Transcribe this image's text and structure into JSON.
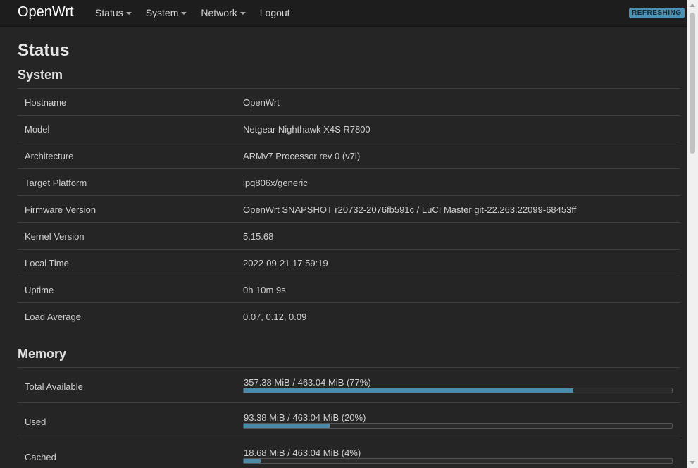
{
  "nav": {
    "brand": "OpenWrt",
    "menu": [
      {
        "label": "Status",
        "has_dropdown": true
      },
      {
        "label": "System",
        "has_dropdown": true
      },
      {
        "label": "Network",
        "has_dropdown": true
      },
      {
        "label": "Logout",
        "has_dropdown": false
      }
    ],
    "badge": "REFRESHING"
  },
  "page_title": "Status",
  "system": {
    "title": "System",
    "rows": [
      {
        "label": "Hostname",
        "value": "OpenWrt"
      },
      {
        "label": "Model",
        "value": "Netgear Nighthawk X4S R7800"
      },
      {
        "label": "Architecture",
        "value": "ARMv7 Processor rev 0 (v7l)"
      },
      {
        "label": "Target Platform",
        "value": "ipq806x/generic"
      },
      {
        "label": "Firmware Version",
        "value": "OpenWrt SNAPSHOT r20732-2076fb591c / LuCI Master git-22.263.22099-68453ff"
      },
      {
        "label": "Kernel Version",
        "value": "5.15.68"
      },
      {
        "label": "Local Time",
        "value": "2022-09-21 17:59:19"
      },
      {
        "label": "Uptime",
        "value": "0h 10m 9s"
      },
      {
        "label": "Load Average",
        "value": "0.07, 0.12, 0.09"
      }
    ]
  },
  "memory": {
    "title": "Memory",
    "rows": [
      {
        "label": "Total Available",
        "text": "357.38 MiB / 463.04 MiB (77%)",
        "percent": 77
      },
      {
        "label": "Used",
        "text": "93.38 MiB / 463.04 MiB (20%)",
        "percent": 20
      },
      {
        "label": "Cached",
        "text": "18.68 MiB / 463.04 MiB (4%)",
        "percent": 4
      }
    ]
  },
  "colors": {
    "accent": "#4a8aab",
    "badge": "#4a91b3",
    "background": "#252525",
    "navbar": "#1d1d1d"
  }
}
